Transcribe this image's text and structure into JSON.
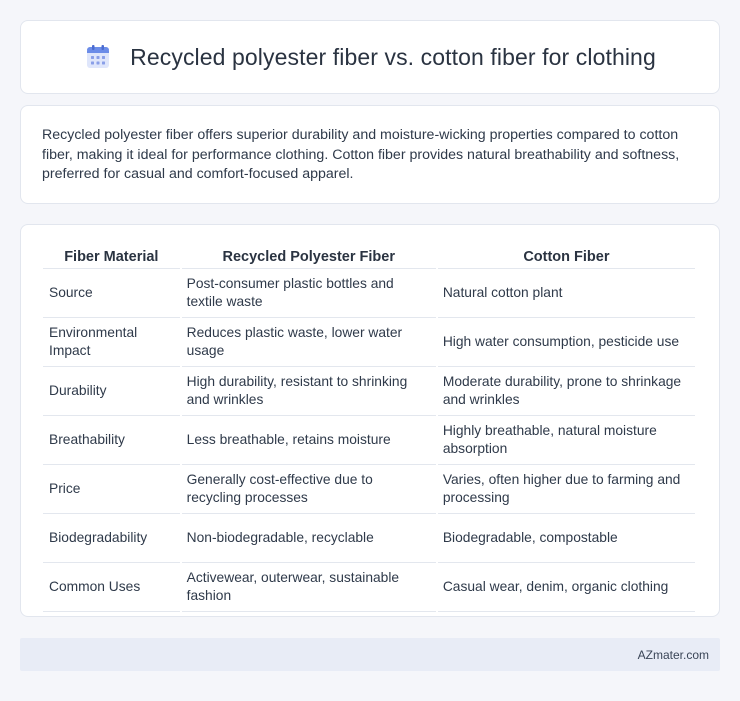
{
  "header": {
    "title": "Recycled polyester fiber vs. cotton fiber for clothing",
    "icon": "calendar-icon"
  },
  "summary": {
    "text": "Recycled polyester fiber offers superior durability and moisture-wicking properties compared to cotton fiber, making it ideal for performance clothing. Cotton fiber provides natural breathability and softness, preferred for casual and comfort-focused apparel."
  },
  "table": {
    "headers": [
      "Fiber Material",
      "Recycled Polyester Fiber",
      "Cotton Fiber"
    ],
    "rows": [
      [
        "Source",
        "Post-consumer plastic bottles and textile waste",
        "Natural cotton plant"
      ],
      [
        "Environmental Impact",
        "Reduces plastic waste, lower water usage",
        "High water consumption, pesticide use"
      ],
      [
        "Durability",
        "High durability, resistant to shrinking and wrinkles",
        "Moderate durability, prone to shrinkage and wrinkles"
      ],
      [
        "Breathability",
        "Less breathable, retains moisture",
        "Highly breathable, natural moisture absorption"
      ],
      [
        "Price",
        "Generally cost-effective due to recycling processes",
        "Varies, often higher due to farming and processing"
      ],
      [
        "Biodegradability",
        "Non-biodegradable, recyclable",
        "Biodegradable, compostable"
      ],
      [
        "Common Uses",
        "Activewear, outerwear, sustainable fashion",
        "Casual wear, denim, organic clothing"
      ]
    ]
  },
  "footer": {
    "text": "AZmater.com"
  },
  "colors": {
    "accent": "#5b7fe0",
    "background": "#f5f6fa",
    "footer_bg": "#e8ecf6"
  }
}
